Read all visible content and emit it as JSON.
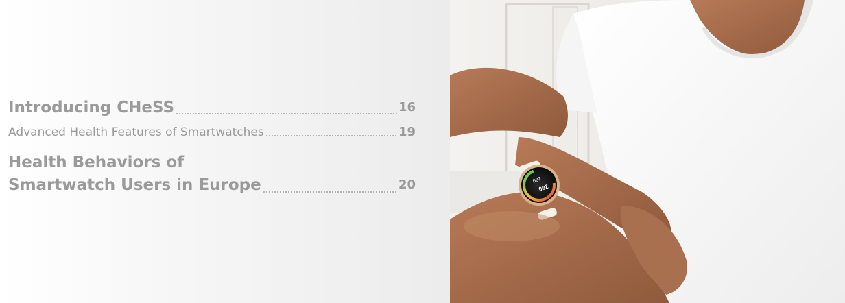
{
  "toc": {
    "entries": [
      {
        "title": "Introducing CHeSS",
        "page": "16"
      },
      {
        "title": "Advanced Health Features of Smartwatches",
        "page": "19"
      },
      {
        "title_line_1": "Health Behaviors of",
        "title_line_2": "Smartwatch Users in Europe",
        "page": "20"
      }
    ]
  },
  "photo": {
    "watch": {
      "screen_values": [
        "200",
        "200"
      ]
    }
  }
}
